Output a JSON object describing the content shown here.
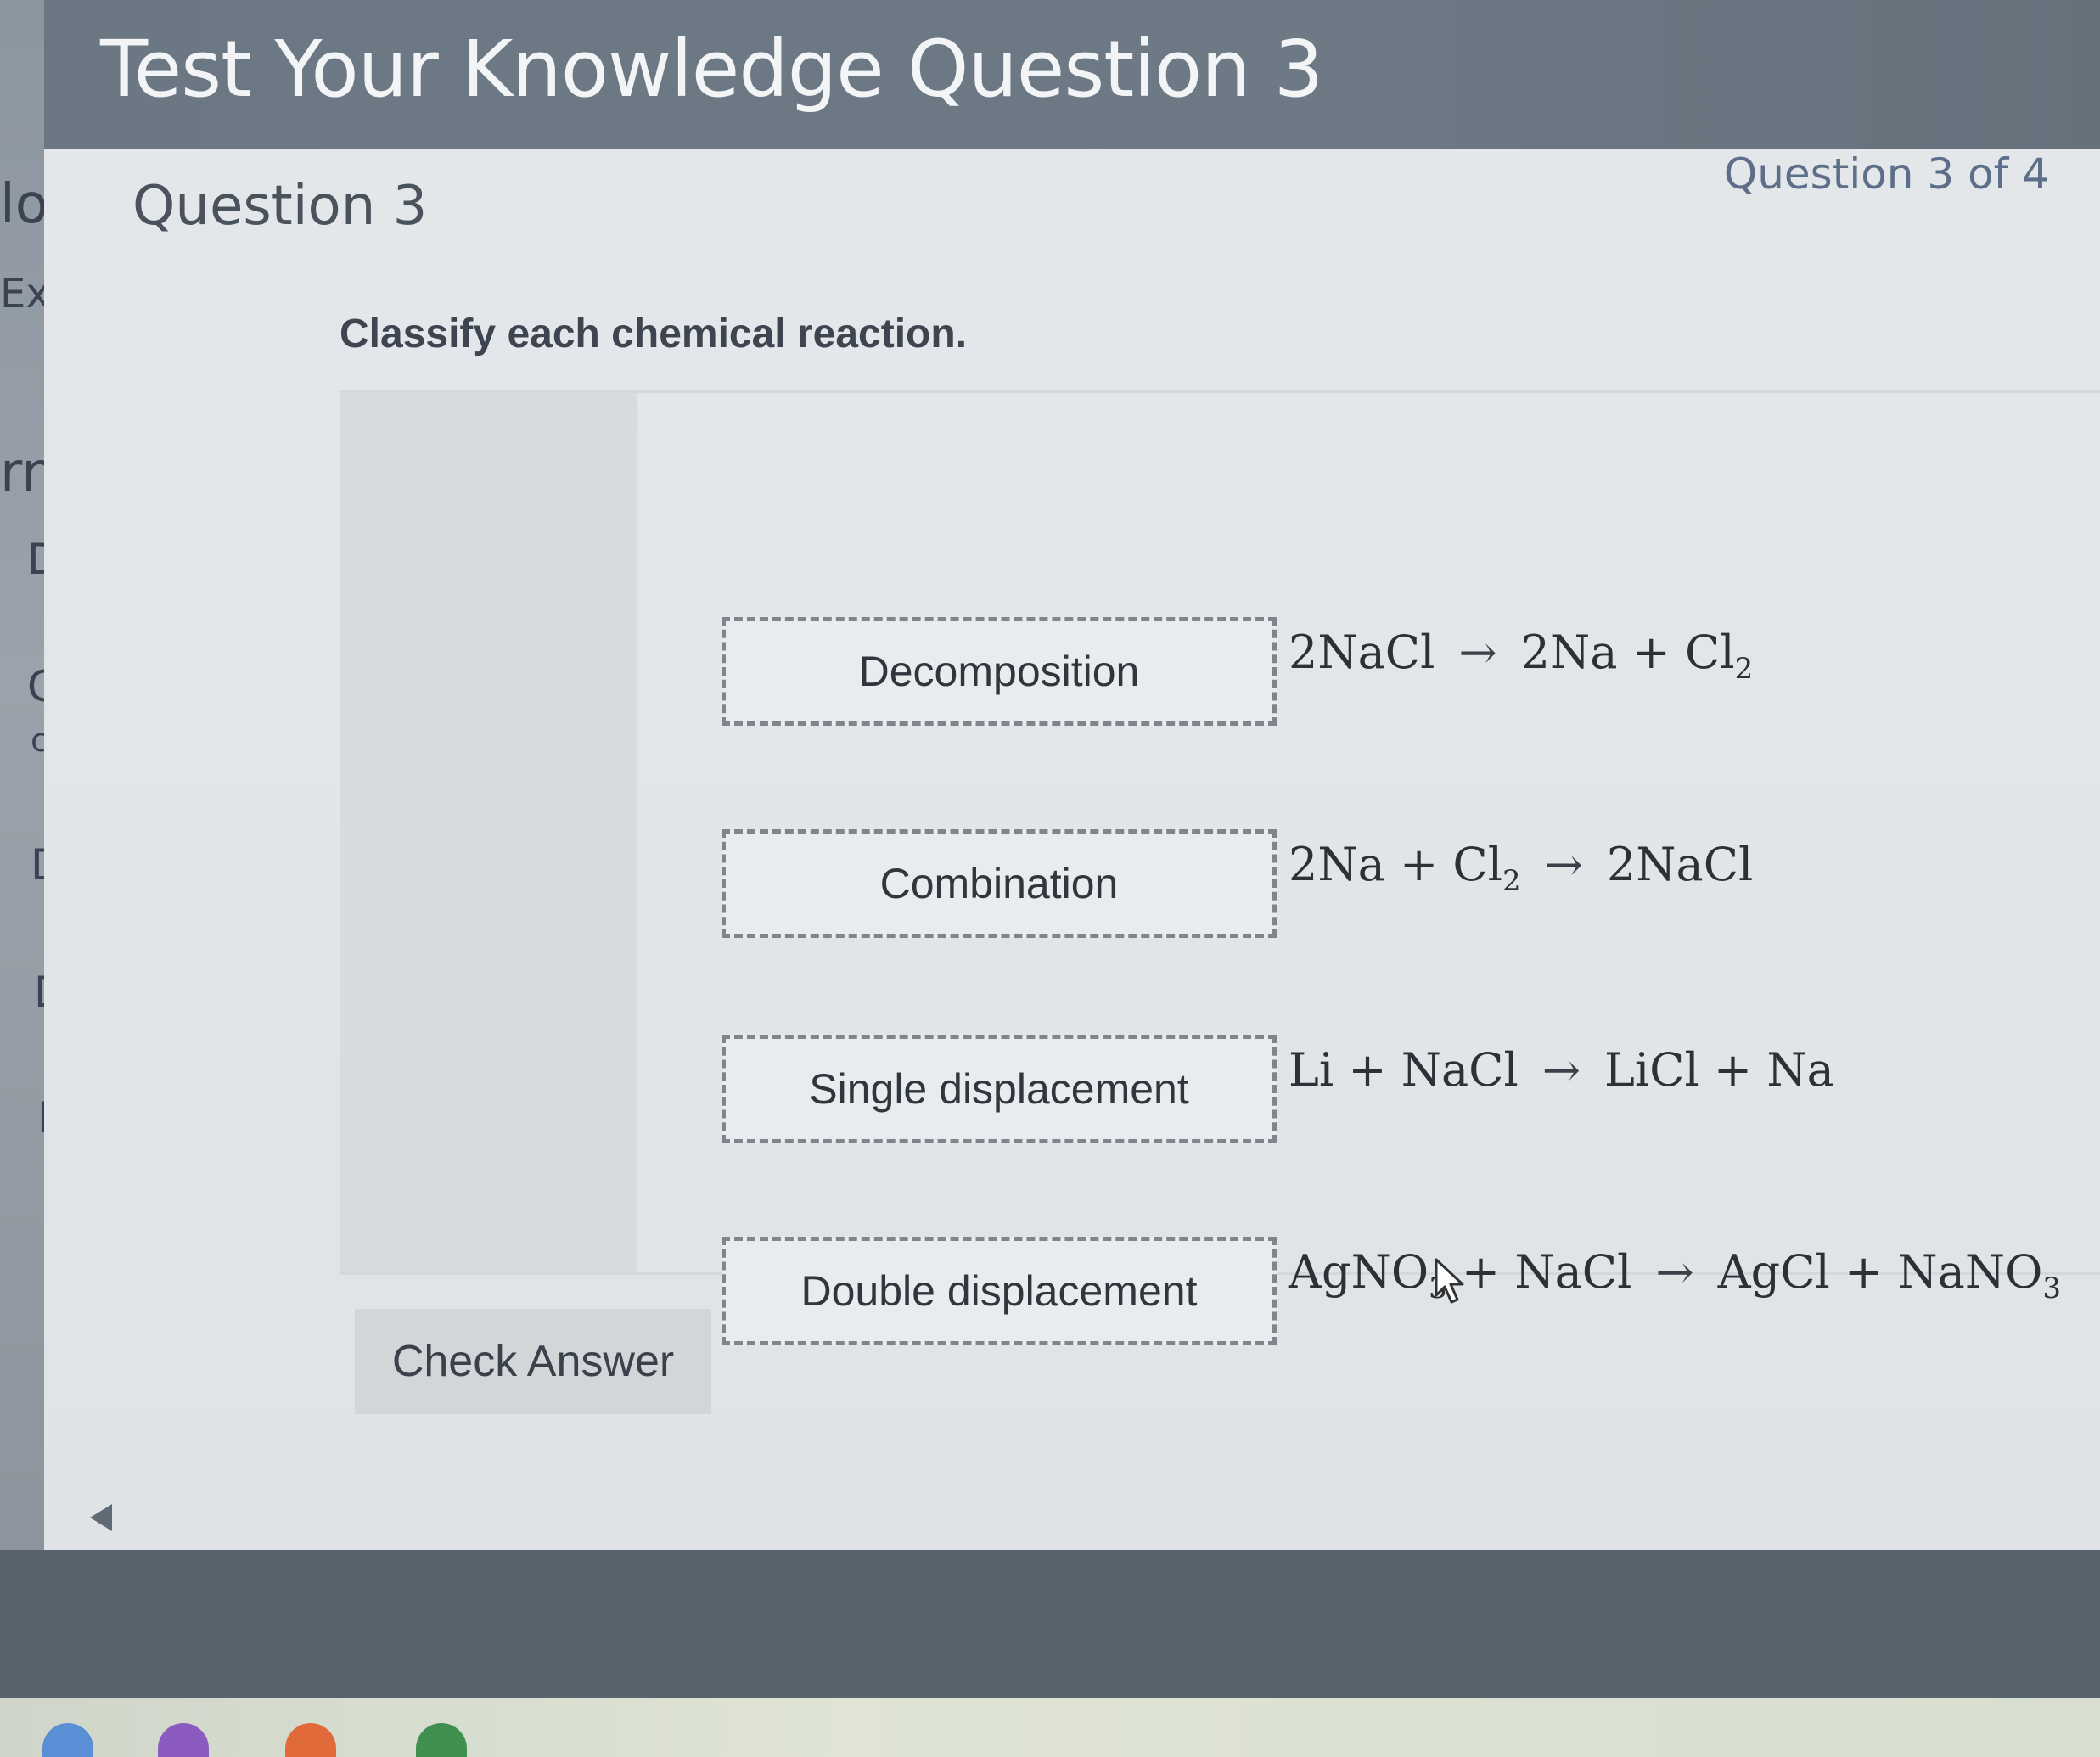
{
  "header": {
    "title": "Test Your Knowledge Question 3"
  },
  "question": {
    "heading": "Question 3",
    "progress": "Question 3 of 4",
    "prompt": "Classify each chemical reaction."
  },
  "rows": [
    {
      "category": "Decomposition",
      "reaction_left": [
        "2NaCl"
      ],
      "reaction_right": [
        "2Na",
        "+",
        "Cl",
        "2"
      ]
    },
    {
      "category": "Combination",
      "reaction_left": [
        "2Na",
        "+",
        "Cl",
        "2"
      ],
      "reaction_right": [
        "2NaCl"
      ]
    },
    {
      "category": "Single displacement",
      "reaction_left": [
        "Li",
        "+",
        "NaCl"
      ],
      "reaction_right": [
        "LiCl",
        "+",
        "Na"
      ]
    },
    {
      "category": "Double displacement",
      "reaction_left": [
        "AgNO",
        "3",
        "+",
        "NaCl"
      ],
      "reaction_right": [
        "AgCl",
        "+",
        "NaNO",
        "3"
      ]
    }
  ],
  "arrow": "→",
  "check_answer_label": "Check Answer",
  "sidebar_fragments": [
    "lo",
    "Ex",
    "rn",
    "D",
    "C",
    "c",
    "D",
    "D",
    "D"
  ]
}
